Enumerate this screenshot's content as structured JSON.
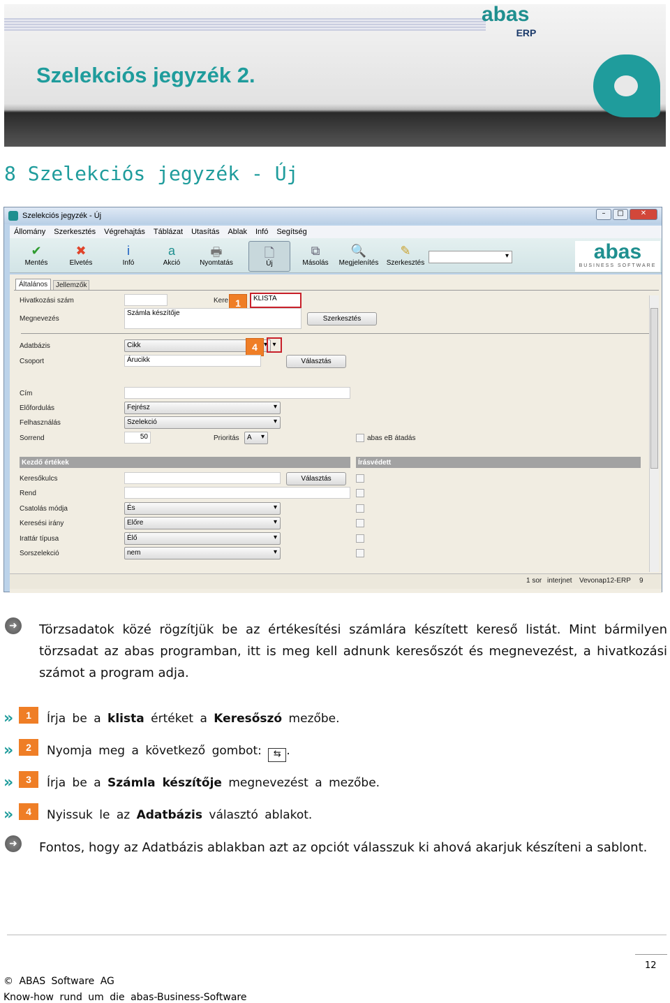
{
  "header": {
    "title": "Szelekciós jegyzék 2.",
    "logo_top": "abas",
    "logo_sub": "ERP"
  },
  "section_heading": "8 Szelekciós jegyzék - Új",
  "window": {
    "title": "Szelekciós jegyzék - Új",
    "menu": [
      "Állomány",
      "Szerkesztés",
      "Végrehajtás",
      "Táblázat",
      "Utasítás",
      "Ablak",
      "Infó",
      "Segítség"
    ],
    "toolbar": [
      {
        "label": "Mentés",
        "icon": "check-icon",
        "color": "#2e9b2e"
      },
      {
        "label": "Elvetés",
        "icon": "x-icon",
        "color": "#e0442a"
      },
      {
        "label": "Infó",
        "icon": "info-icon",
        "color": "#1a5fc0"
      },
      {
        "label": "Akció",
        "icon": "abas-a-icon",
        "color": "#1f8f8f"
      },
      {
        "label": "Nyomtatás",
        "icon": "printer-icon",
        "color": "#777"
      },
      {
        "label": "Új",
        "icon": "new-document-icon",
        "color": "#667"
      },
      {
        "label": "Másolás",
        "icon": "copy-icon",
        "color": "#667"
      },
      {
        "label": "Megjelenítés",
        "icon": "magnifier-icon",
        "color": "#4a7fb0"
      },
      {
        "label": "Szerkesztés",
        "icon": "edit-icon",
        "color": "#c9a02a"
      }
    ],
    "brand": "abas",
    "brand_sub": "BUSINESS SOFTWARE",
    "tabs": [
      "Általános",
      "Jellemzők"
    ],
    "form": {
      "hivatkozasi_szam": "Hivatkozási szám",
      "kereso_label": "Kere",
      "kereso_value": "KLISTA",
      "megnevezes": "Megnevezés",
      "megnevezes_value": "Számla készítője",
      "szerkesztes": "Szerkesztés",
      "adatbazis": "Adatbázis",
      "adatbazis_value": "Cikk",
      "csoport": "Csoport",
      "csoport_value": "Árucikk",
      "valasztas": "Választás",
      "cim": "Cím",
      "elofordulas": "Előfordulás",
      "elofordulas_value": "Fejrész",
      "felhasznalas": "Felhasználás",
      "felhasznalas_value": "Szelekció",
      "sorrend": "Sorrend",
      "sorrend_value": "50",
      "prioritas": "Prioritás",
      "prioritas_value": "A",
      "abas_eb": "abas eB átadás"
    },
    "bar_left": "Kezdő értékek",
    "bar_right": "Írásvédett",
    "rows": [
      {
        "label": "Keresőkulcs",
        "type": "input"
      },
      {
        "label": "Rend",
        "type": "input"
      },
      {
        "label": "Csatolás módja",
        "value": "És"
      },
      {
        "label": "Keresési irány",
        "value": "Előre"
      },
      {
        "label": "Irattár típusa",
        "value": "Élő"
      },
      {
        "label": "Sorszelekció",
        "value": "nem"
      }
    ],
    "badges": [
      "1",
      "4"
    ],
    "status": [
      "1 sor",
      "interjnet",
      "Vevonap12-ERP",
      "9"
    ]
  },
  "para1": "Törzsadatok közé rögzítjük be az értékesítési számlára készített kereső listát. Mint bármilyen törzsadat az abas programban, itt is meg kell adnunk keresőszót és megnevezést, a hivatkozási számot a program adja.",
  "steps": [
    {
      "n": "1",
      "text": [
        "Írja be a ",
        "klista",
        " értéket a ",
        "Keresőszó",
        " mezőbe."
      ]
    },
    {
      "n": "2",
      "text": [
        "Nyomja meg a következő gombot: ",
        "",
        ".",
        "",
        " "
      ]
    },
    {
      "n": "3",
      "text": [
        "Írja be a ",
        "Számla készítője",
        " megnevezést a mezőbe.",
        "",
        ""
      ]
    },
    {
      "n": "4",
      "text": [
        "Nyissuk le az ",
        "Adatbázis",
        " választó ablakot.",
        "",
        ""
      ]
    }
  ],
  "para2": "Fontos, hogy az Adatbázis ablakban azt az opciót válasszuk ki ahová akarjuk készíteni a sablont.",
  "footer": {
    "page": "12",
    "copyright": "© ABAS Software AG",
    "tagline": "Know-how rund um die abas-Business-Software"
  }
}
